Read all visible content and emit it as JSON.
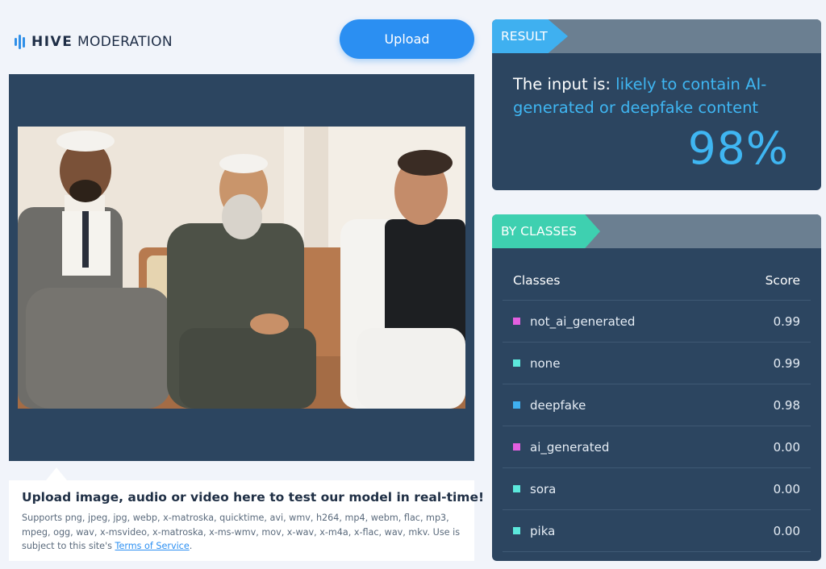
{
  "brand": {
    "name_bold": "HIVE",
    "name_light": "MODERATION"
  },
  "upload": {
    "label": "Upload"
  },
  "info": {
    "title": "Upload image, audio or video here to test our model in real-time!",
    "body": "Supports png, jpeg, jpg, webp, x-matroska, quicktime, avi, wmv, h264, mp4, webm, flac, mp3, mpeg, ogg, wav, x-msvideo, x-matroska, x-ms-wmv, mov, x-wav, x-m4a, x-flac, wav, mkv. Use is subject to this site's ",
    "link": "Terms of Service",
    "suffix": "."
  },
  "result": {
    "tag": "RESULT",
    "prefix": "The input is: ",
    "verdict": "likely to contain AI-generated or deepfake content",
    "percent": "98%"
  },
  "classes": {
    "tag": "BY CLASSES",
    "col_classes": "Classes",
    "col_score": "Score",
    "rows": [
      {
        "name": "not_ai_generated",
        "score": "0.99",
        "color": "#e45fe0"
      },
      {
        "name": "none",
        "score": "0.99",
        "color": "#5ce8dc"
      },
      {
        "name": "deepfake",
        "score": "0.98",
        "color": "#3fb0f0"
      },
      {
        "name": "ai_generated",
        "score": "0.00",
        "color": "#e45fe0"
      },
      {
        "name": "sora",
        "score": "0.00",
        "color": "#5ce8dc"
      },
      {
        "name": "pika",
        "score": "0.00",
        "color": "#5ce8dc"
      }
    ]
  },
  "colors": {
    "accent": "#2b8ff2",
    "panel": "#2c4560",
    "result_tag": "#3fb0f0",
    "classes_tag": "#3ed0b0"
  },
  "icons": {
    "logo": "hive-bars-icon"
  }
}
